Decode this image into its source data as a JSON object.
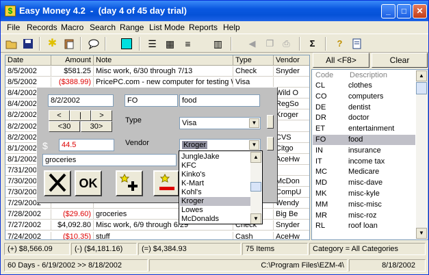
{
  "window": {
    "title": "Easy Money 4.2  -  (day 4 of 45 day trial)",
    "minimize": "_",
    "maximize": "□",
    "close": "✕",
    "app_icon": "$"
  },
  "menu": [
    "File",
    "Records",
    "Macro",
    "Search",
    "Range",
    "List Mode",
    "Reports",
    "Help"
  ],
  "toolbar": {
    "sigma": "Σ"
  },
  "grid": {
    "columns": [
      "Date",
      "Amount",
      "Note",
      "Type",
      "Vendor"
    ],
    "rows": [
      {
        "date": "8/5/2002",
        "amount": "$581.25",
        "neg": false,
        "note": "Misc work, 6/30 through 7/13",
        "type": "Check",
        "vendor": "Snyder"
      },
      {
        "date": "8/5/2002",
        "amount": "($388.99)",
        "neg": true,
        "note": "PricePC.com - new computer for testing Web",
        "type": "Visa",
        "vendor": ""
      },
      {
        "date": "8/4/2002",
        "amount": "",
        "neg": false,
        "note": "",
        "type": "",
        "vendor": "Wild O"
      },
      {
        "date": "8/4/2002",
        "amount": "",
        "neg": false,
        "note": "",
        "type": "",
        "vendor": "RegSo"
      },
      {
        "date": "8/2/2002",
        "amount": "",
        "neg": false,
        "note": "",
        "type": "",
        "vendor": "Kroger"
      },
      {
        "date": "8/2/2002",
        "amount": "",
        "neg": false,
        "note": "",
        "type": "",
        "vendor": ""
      },
      {
        "date": "8/2/2002",
        "amount": "",
        "neg": false,
        "note": "",
        "type": "",
        "vendor": "CVS"
      },
      {
        "date": "8/1/2002",
        "amount": "",
        "neg": false,
        "note": "",
        "type": "",
        "vendor": "Citgo"
      },
      {
        "date": "8/1/2002",
        "amount": "",
        "neg": false,
        "note": "",
        "type": "",
        "vendor": "AceHw"
      },
      {
        "date": "7/31/2002",
        "amount": "",
        "neg": false,
        "note": "",
        "type": "",
        "vendor": ""
      },
      {
        "date": "7/30/2002",
        "amount": "",
        "neg": false,
        "note": "",
        "type": "",
        "vendor": "McDon"
      },
      {
        "date": "7/30/2002",
        "amount": "",
        "neg": false,
        "note": "",
        "type": "",
        "vendor": "CompU"
      },
      {
        "date": "7/29/2002",
        "amount": "",
        "neg": false,
        "note": "",
        "type": "",
        "vendor": "Wendy"
      },
      {
        "date": "7/28/2002",
        "amount": "($29.60)",
        "neg": true,
        "note": "groceries",
        "type": "Visa",
        "vendor": "Big Be"
      },
      {
        "date": "7/27/2002",
        "amount": "$4,092.80",
        "neg": false,
        "note": "Misc work, 6/9 through 6/29",
        "type": "Check",
        "vendor": "Snyder"
      },
      {
        "date": "7/24/2002",
        "amount": "($10.35)",
        "neg": true,
        "note": "stuff",
        "type": "Cash",
        "vendor": "AceHw"
      }
    ]
  },
  "right_panel": {
    "all_button": "All <F8>",
    "clear_button": "Clear",
    "headers": [
      "Code",
      "Description"
    ],
    "categories": [
      {
        "code": "CL",
        "desc": "clothes"
      },
      {
        "code": "CO",
        "desc": "computers"
      },
      {
        "code": "DE",
        "desc": "dentist"
      },
      {
        "code": "DR",
        "desc": "doctor"
      },
      {
        "code": "ET",
        "desc": "entertainment"
      },
      {
        "code": "FO",
        "desc": "food"
      },
      {
        "code": "IN",
        "desc": "insurance"
      },
      {
        "code": "IT",
        "desc": "income tax"
      },
      {
        "code": "MC",
        "desc": "Medicare"
      },
      {
        "code": "MD",
        "desc": "misc-dave"
      },
      {
        "code": "MK",
        "desc": "misc-kyle"
      },
      {
        "code": "MM",
        "desc": "misc-misc"
      },
      {
        "code": "MR",
        "desc": "misc-roz"
      },
      {
        "code": "RL",
        "desc": "roof loan"
      }
    ],
    "selected_code": "FO"
  },
  "editor": {
    "date": "8/2/2002",
    "nav_prev": "<",
    "nav_today": "|",
    "nav_next": ">",
    "nav_prev30": "<30",
    "nav_next30": "30>",
    "cat_code": "FO",
    "cat_desc": "food",
    "type_label": "Type",
    "type_value": "Visa",
    "vendor_label": "Vendor",
    "vendor_value": "Kroger",
    "dollar": "$",
    "amount": "44.5",
    "note": "groceries",
    "ok_label": "OK"
  },
  "vendor_dropdown": {
    "items": [
      "JungleJake",
      "KFC",
      "Kinko's",
      "K-Mart",
      "Kohl's",
      "Kroger",
      "Lowes",
      "McDonalds"
    ],
    "selected": "Kroger"
  },
  "status": {
    "credits": "(+) $8,566.09",
    "debits": "(-) ($4,181.16)",
    "balance": "(=) $4,384.93",
    "items": "75 Items",
    "category": "Category = All Categories",
    "range": "60 Days - 6/19/2002 >> 8/18/2002",
    "path": "C:\\Program Files\\EZM-4\\",
    "date": "8/18/2002"
  },
  "colors": {
    "titlebar": "#0a58e0",
    "negative": "#dd0000",
    "selection": "#c0c0c8",
    "dialog_bg": "#c0c0c0",
    "highlight_cyan": "#00e0e0"
  }
}
